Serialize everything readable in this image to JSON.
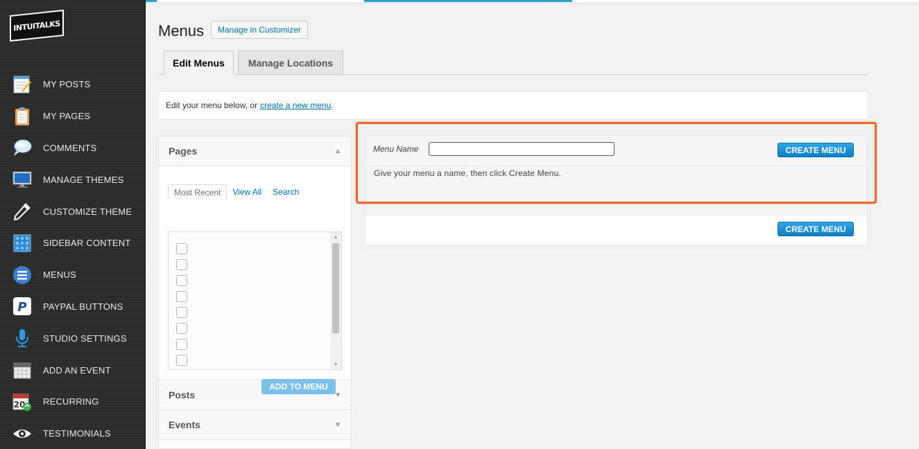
{
  "sidebar": {
    "logo_text": "INTUITALKS",
    "items": [
      {
        "label": "MY POSTS",
        "icon": "notepad-pencil-icon"
      },
      {
        "label": "MY PAGES",
        "icon": "clipboard-icon"
      },
      {
        "label": "COMMENTS",
        "icon": "speech-bubble-icon"
      },
      {
        "label": "MANAGE THEMES",
        "icon": "monitor-icon"
      },
      {
        "label": "CUSTOMIZE THEME",
        "icon": "eyedropper-icon"
      },
      {
        "label": "SIDEBAR CONTENT",
        "icon": "grid-panel-icon"
      },
      {
        "label": "MENUS",
        "icon": "menu-lines-icon"
      },
      {
        "label": "PAYPAL BUTTONS",
        "icon": "paypal-icon"
      },
      {
        "label": "STUDIO SETTINGS",
        "icon": "microphone-icon"
      },
      {
        "label": "ADD AN EVENT",
        "icon": "calendar-icon"
      },
      {
        "label": "RECURRING",
        "icon": "calendar-recurring-icon"
      },
      {
        "label": "TESTIMONIALS",
        "icon": "eye-icon"
      }
    ]
  },
  "header": {
    "title": "Menus",
    "customizer_label": "Manage in Customizer"
  },
  "tabs": [
    {
      "label": "Edit Menus",
      "active": true
    },
    {
      "label": "Manage Locations",
      "active": false
    }
  ],
  "info": {
    "prefix": "Edit your menu below, or",
    "link": "create a new menu",
    "suffix": "."
  },
  "accordion": {
    "pages_title": "Pages",
    "subtabs": [
      "Most Recent",
      "View All",
      "Search"
    ],
    "add_button": "ADD TO MENU",
    "posts_title": "Posts",
    "events_title": "Events"
  },
  "menu_panel": {
    "name_label": "Menu Name",
    "name_value": "",
    "create_label": "CREATE MENU",
    "help_text": "Give your menu a name, then click Create Menu."
  },
  "colors": {
    "sidebar_bg": "#2c2c2c",
    "accent_blue": "#0d7fc6",
    "highlight_orange": "#f26522",
    "link_blue": "#0073aa"
  }
}
